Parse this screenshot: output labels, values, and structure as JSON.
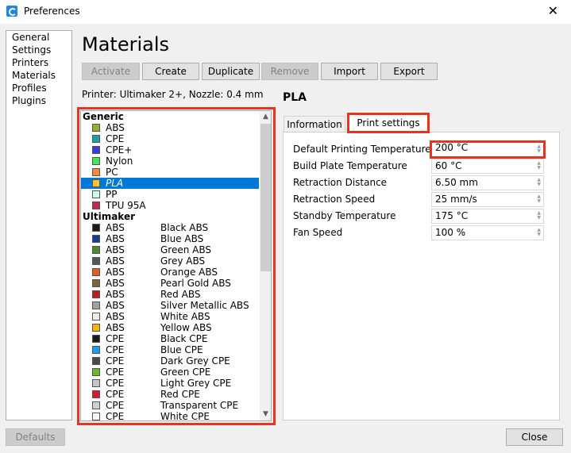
{
  "window": {
    "title": "Preferences",
    "close_glyph": "✕"
  },
  "nav": {
    "items": [
      "General",
      "Settings",
      "Printers",
      "Materials",
      "Profiles",
      "Plugins"
    ]
  },
  "page": {
    "title": "Materials"
  },
  "toolbar": {
    "activate": "Activate",
    "create": "Create",
    "duplicate": "Duplicate",
    "remove": "Remove",
    "import": "Import",
    "export": "Export"
  },
  "printer_info": "Printer: Ultimaker 2+, Nozzle: 0.4 mm",
  "material_list": {
    "generic_heading": "Generic",
    "generic": [
      {
        "name": "ABS",
        "color": "#8fb42b"
      },
      {
        "name": "CPE",
        "color": "#1ba0a8"
      },
      {
        "name": "CPE+",
        "color": "#3a3ae8"
      },
      {
        "name": "Nylon",
        "color": "#3fe858"
      },
      {
        "name": "PC",
        "color": "#f58a38"
      },
      {
        "name": "PLA",
        "color": "#ffc72c"
      },
      {
        "name": "PP",
        "color": "#c8fff0"
      },
      {
        "name": "TPU 95A",
        "color": "#c7254e"
      }
    ],
    "ultimaker_heading": "Ultimaker",
    "ultimaker": [
      {
        "type": "ABS",
        "name": "Black ABS",
        "color": "#1a1a1a"
      },
      {
        "type": "ABS",
        "name": "Blue ABS",
        "color": "#123e9a"
      },
      {
        "type": "ABS",
        "name": "Green ABS",
        "color": "#4e8a2c"
      },
      {
        "type": "ABS",
        "name": "Grey ABS",
        "color": "#52595d"
      },
      {
        "type": "ABS",
        "name": "Orange ABS",
        "color": "#e45a1f"
      },
      {
        "type": "ABS",
        "name": "Pearl Gold ABS",
        "color": "#80643f"
      },
      {
        "type": "ABS",
        "name": "Red ABS",
        "color": "#c01a1a"
      },
      {
        "type": "ABS",
        "name": "Silver Metallic ABS",
        "color": "#a1a1a0"
      },
      {
        "type": "ABS",
        "name": "White ABS",
        "color": "#f1ece1"
      },
      {
        "type": "ABS",
        "name": "Yellow ABS",
        "color": "#f7b500"
      },
      {
        "type": "CPE",
        "name": "Black CPE",
        "color": "#1a1a1a"
      },
      {
        "type": "CPE",
        "name": "Blue CPE",
        "color": "#1aa0e8"
      },
      {
        "type": "CPE",
        "name": "Dark Grey CPE",
        "color": "#4a4a4a"
      },
      {
        "type": "CPE",
        "name": "Green CPE",
        "color": "#6ab82e"
      },
      {
        "type": "CPE",
        "name": "Light Grey CPE",
        "color": "#c6c6c6"
      },
      {
        "type": "CPE",
        "name": "Red CPE",
        "color": "#d8172f"
      },
      {
        "type": "CPE",
        "name": "Transparent CPE",
        "color": "#d0d0d0"
      },
      {
        "type": "CPE",
        "name": "White CPE",
        "color": "#fbfbfb"
      }
    ],
    "selected": "PLA"
  },
  "detail": {
    "material_name": "PLA",
    "tab_information": "Information",
    "tab_print_settings": "Print settings",
    "settings": [
      {
        "label": "Default Printing Temperature",
        "value": "200 °C"
      },
      {
        "label": "Build Plate Temperature",
        "value": "60 °C"
      },
      {
        "label": "Retraction Distance",
        "value": "6.50 mm"
      },
      {
        "label": "Retraction Speed",
        "value": "25 mm/s"
      },
      {
        "label": "Standby Temperature",
        "value": "175 °C"
      },
      {
        "label": "Fan Speed",
        "value": "100 %"
      }
    ]
  },
  "footer": {
    "defaults": "Defaults",
    "close": "Close"
  },
  "colors": {
    "highlight": "#e8341c",
    "selection": "#0078d7"
  }
}
